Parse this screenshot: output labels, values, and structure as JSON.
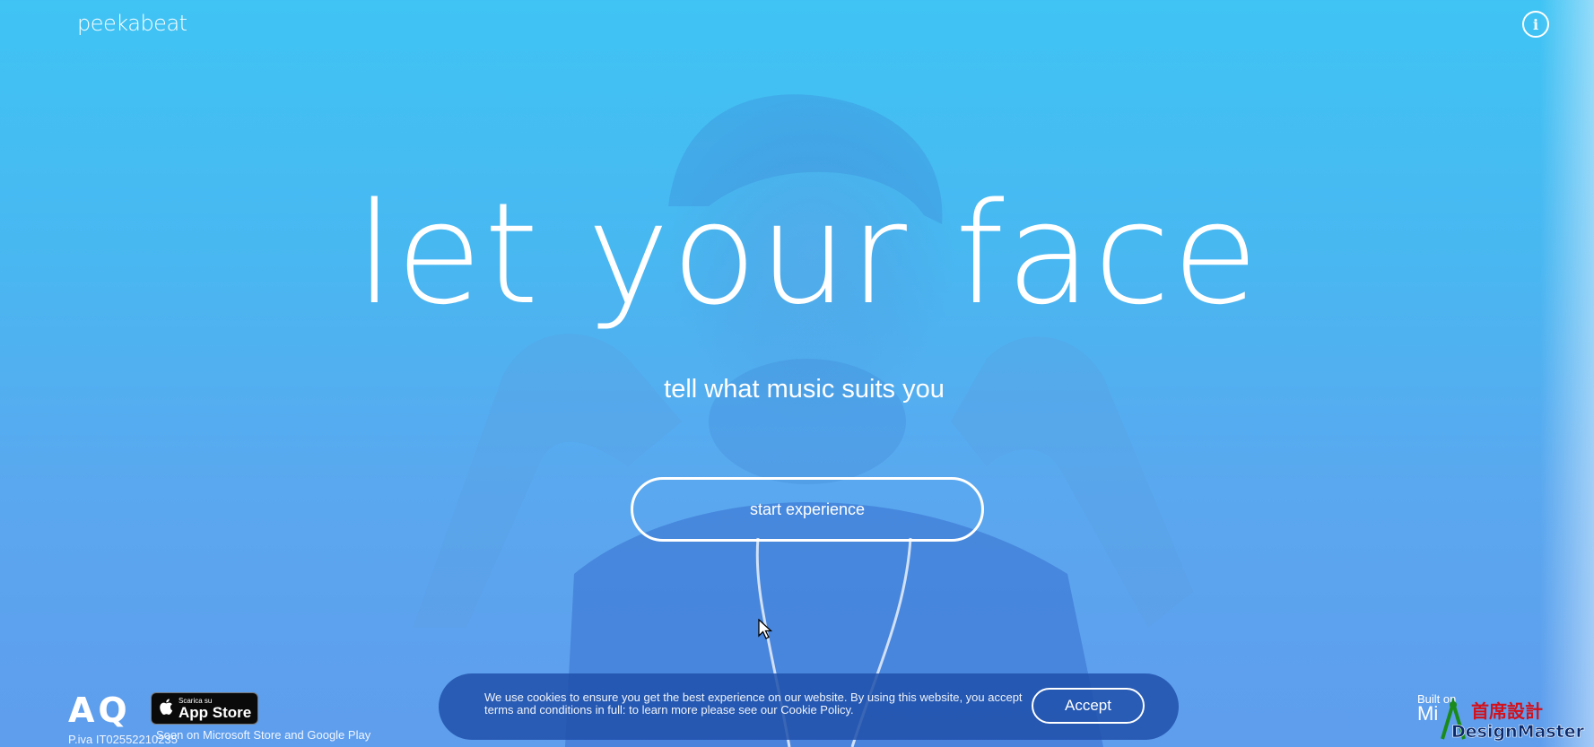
{
  "header": {
    "logo": "peekabeat",
    "info_label": "i"
  },
  "hero": {
    "headline": "let your face",
    "subheadline": "tell what music suits you",
    "cta_label": "start experience"
  },
  "footer": {
    "aq_logo": "AQ",
    "app_store": {
      "small_label": "Scarica su",
      "big_label": "App Store"
    },
    "stores_text": "Soon on Microsoft Store and Google Play",
    "piva_text": "P.iva IT02552210235",
    "built_on": "Built on",
    "built_on_brand": "Mi"
  },
  "cookie": {
    "text": "We use cookies to ensure you get the best experience on our website. By using this website, you accept terms and conditions in full: to learn more please see our Cookie Policy.",
    "accept_label": "Accept"
  },
  "watermark": {
    "text_cn": "首席設計",
    "text_en": "DesignMaster"
  },
  "colors": {
    "bg_top": "#3fc4f4",
    "bg_bottom": "#5f9ded",
    "cookie_bar": "#2050aa",
    "text": "#ffffff"
  }
}
